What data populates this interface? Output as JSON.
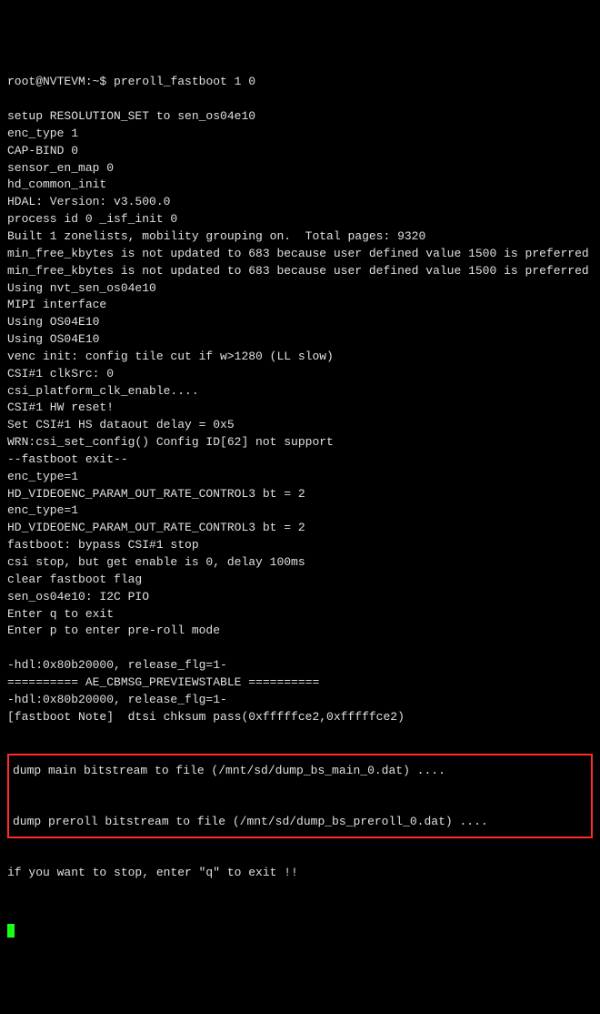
{
  "prompt": {
    "user_host_path": "root@NVTEVM:~$",
    "command": "preroll_fastboot 1 0"
  },
  "lines": [
    "setup RESOLUTION_SET to sen_os04e10",
    "enc_type 1",
    "CAP-BIND 0",
    "sensor_en_map 0",
    "hd_common_init",
    "HDAL: Version: v3.500.0",
    "process id 0 _isf_init 0",
    "Built 1 zonelists, mobility grouping on.  Total pages: 9320",
    "min_free_kbytes is not updated to 683 because user defined value 1500 is preferred",
    "min_free_kbytes is not updated to 683 because user defined value 1500 is preferred",
    "Using nvt_sen_os04e10",
    "MIPI interface",
    "Using OS04E10",
    "Using OS04E10",
    "venc init: config tile cut if w>1280 (LL slow)",
    "CSI#1 clkSrc: 0",
    "csi_platform_clk_enable....",
    "CSI#1 HW reset!",
    "Set CSI#1 HS dataout delay = 0x5",
    "WRN:csi_set_config() Config ID[62] not support",
    "--fastboot exit--",
    "enc_type=1",
    "HD_VIDEOENC_PARAM_OUT_RATE_CONTROL3 bt = 2",
    "enc_type=1",
    "HD_VIDEOENC_PARAM_OUT_RATE_CONTROL3 bt = 2",
    "fastboot: bypass CSI#1 stop",
    "csi stop, but get enable is 0, delay 100ms",
    "clear fastboot flag",
    "sen_os04e10: I2C PIO",
    "Enter q to exit",
    "Enter p to enter pre-roll mode",
    "",
    "-hdl:0x80b20000, release_flg=1-",
    "========== AE_CBMSG_PREVIEWSTABLE ==========",
    "-hdl:0x80b20000, release_flg=1-",
    "[fastboot Note]  dtsi chksum pass(0xfffffce2,0xfffffce2)"
  ],
  "highlight": {
    "line1": "dump main bitstream to file (/mnt/sd/dump_bs_main_0.dat) ....",
    "line2": "dump preroll bitstream to file (/mnt/sd/dump_bs_preroll_0.dat) ...."
  },
  "footer_line": "if you want to stop, enter \"q\" to exit !!"
}
